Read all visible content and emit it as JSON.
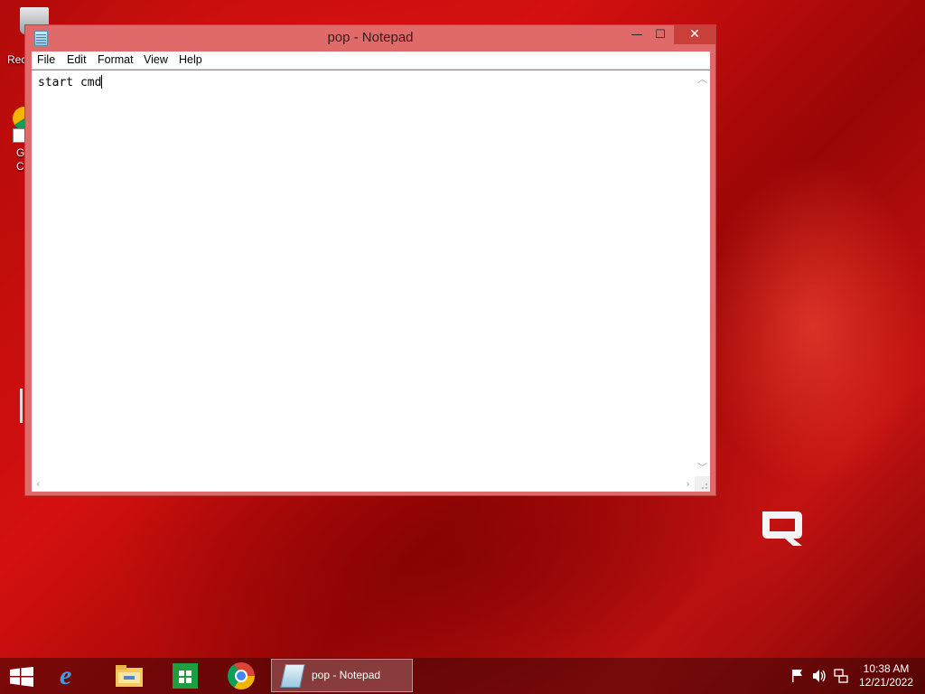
{
  "desktop": {
    "recycle_bin_label": "Rec",
    "chrome_shortcut_label_line1": "G",
    "chrome_shortcut_label_line2": "C"
  },
  "window": {
    "title": "pop - Notepad",
    "controls": {
      "minimize": "—",
      "maximize": "☐",
      "close": "✕"
    },
    "menu": [
      "File",
      "Edit",
      "Format",
      "View",
      "Help"
    ],
    "content": "start cmd"
  },
  "taskbar": {
    "pinned": [
      "Internet Explorer",
      "File Explorer",
      "Store",
      "Google Chrome"
    ],
    "active_task_label": "pop - Notepad",
    "clock_time": "10:38 AM",
    "clock_date": "12/21/2022"
  },
  "colors": {
    "window_frame": "#e06a6a",
    "close_button": "#c9403a",
    "desktop_accent": "#c41212"
  }
}
